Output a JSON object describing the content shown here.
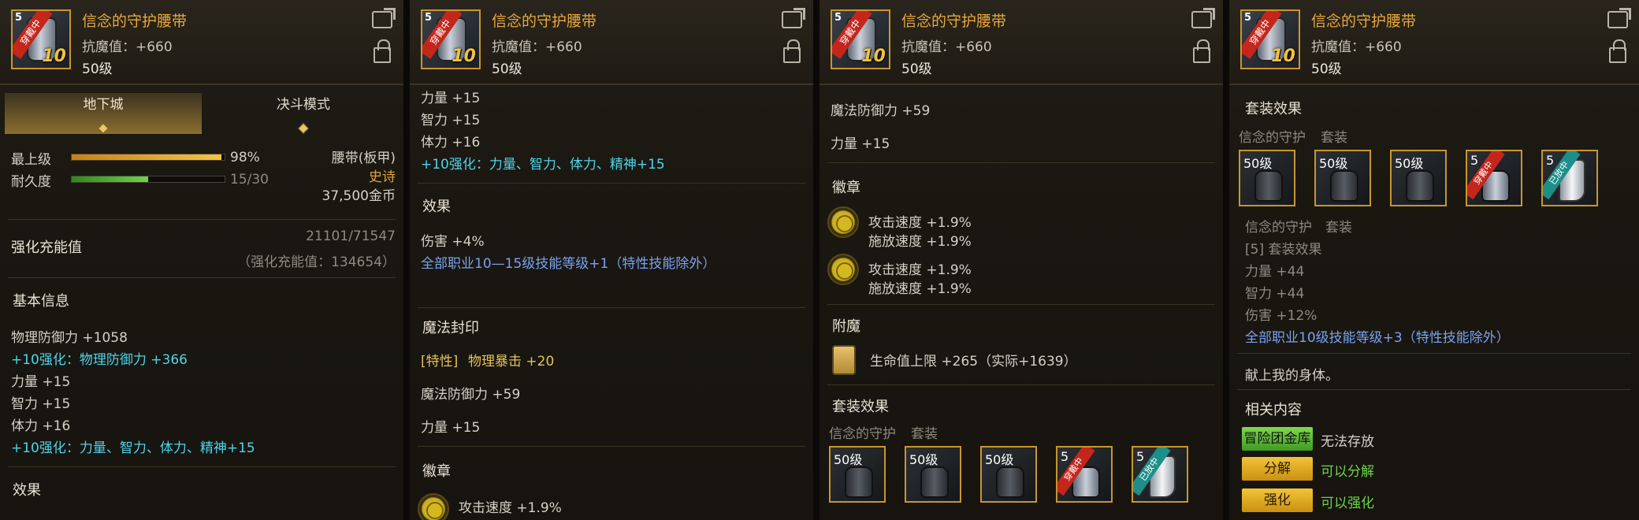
{
  "item": {
    "name": "信念的守护腰带",
    "magic_res": "抗魔值：+660",
    "level": "50级",
    "icon_level": "5",
    "equipped_badge": "穿戴中",
    "enhance_level": "10"
  },
  "p1": {
    "tabs": [
      "地下城",
      "决斗模式"
    ],
    "grade_label": "最上级",
    "grade_value": "98%",
    "grade_pct": 98,
    "dura_label": "耐久度",
    "dura_value": "15/30",
    "dura_pct": 50,
    "type": "腰带(板甲)",
    "rarity": "史诗",
    "price": "37,500金币",
    "charge_label": "强化充能值",
    "charge_value": "21101/71547",
    "charge_detail": "（强化充能值：134654）",
    "basic_title": "基本信息",
    "lines": [
      {
        "text": "物理防御力 +1058",
        "cls": "w"
      },
      {
        "text": "+10强化：物理防御力 +366",
        "cls": "c"
      },
      {
        "text": "力量 +15",
        "cls": "w"
      },
      {
        "text": "智力 +15",
        "cls": "w"
      },
      {
        "text": "体力 +16",
        "cls": "w"
      },
      {
        "text": "+10强化：力量、智力、体力、精神+15",
        "cls": "c"
      }
    ],
    "effect_title": "效果"
  },
  "p2": {
    "lines": [
      "力量 +15",
      "智力 +15",
      "体力 +16"
    ],
    "enh": "+10强化：力量、智力、体力、精神+15",
    "effect_title": "效果",
    "damage": "伤害 +4%",
    "skill": "全部职业10—15级技能等级+1（特性技能除外）",
    "seal_title": "魔法封印",
    "seal_tag": "[特性]",
    "seal_val": "物理暴击 +20",
    "mdef": "魔法防御力 +59",
    "str": "力量 +15",
    "emblem_title": "徽章",
    "emblem_line": "攻击速度 +1.9%"
  },
  "p3": {
    "mdef": "魔法防御力 +59",
    "str": "力量 +15",
    "emblem_title": "徽章",
    "emblems": [
      {
        "a": "攻击速度 +1.9%",
        "b": "施放速度 +1.9%"
      },
      {
        "a": "攻击速度 +1.9%",
        "b": "施放速度 +1.9%"
      }
    ],
    "enchant_title": "附魔",
    "enchant": "生命值上限 +265（实际+1639）",
    "set_title": "套装效果",
    "set_name": "信念的守护",
    "set_tag": "套装",
    "slots": [
      "50级",
      "50级",
      "50级",
      "5",
      "5"
    ],
    "slot_badges": [
      "",
      "",
      "",
      "穿戴中",
      "已放中"
    ]
  },
  "p4": {
    "set_title": "套装效果",
    "set_name": "信念的守护",
    "set_tag": "套装",
    "slots": [
      "50级",
      "50级",
      "50级",
      "5",
      "5"
    ],
    "slot_badges": [
      "",
      "",
      "",
      "穿戴中",
      "已放中"
    ],
    "set_name2": "信念的守护　套装",
    "set_count": "[5] 套装效果",
    "lines": [
      "力量 +44",
      "智力 +44",
      "伤害 +12%"
    ],
    "skill": "全部职业10级技能等级+3（特性技能除外）",
    "flavor": "献上我的身体。",
    "related_title": "相关内容",
    "storage_btn": "冒险团金库",
    "storage_text": "无法存放",
    "dis_btn": "分解",
    "dis_text": "可以分解",
    "enh_btn": "强化",
    "enh_text": "可以强化"
  },
  "colors": {
    "accent": "#e8a93a",
    "cyan": "#4fd4ea",
    "blue": "#79a2f0",
    "green": "#6ed448",
    "gold_border": "#c8962e"
  }
}
